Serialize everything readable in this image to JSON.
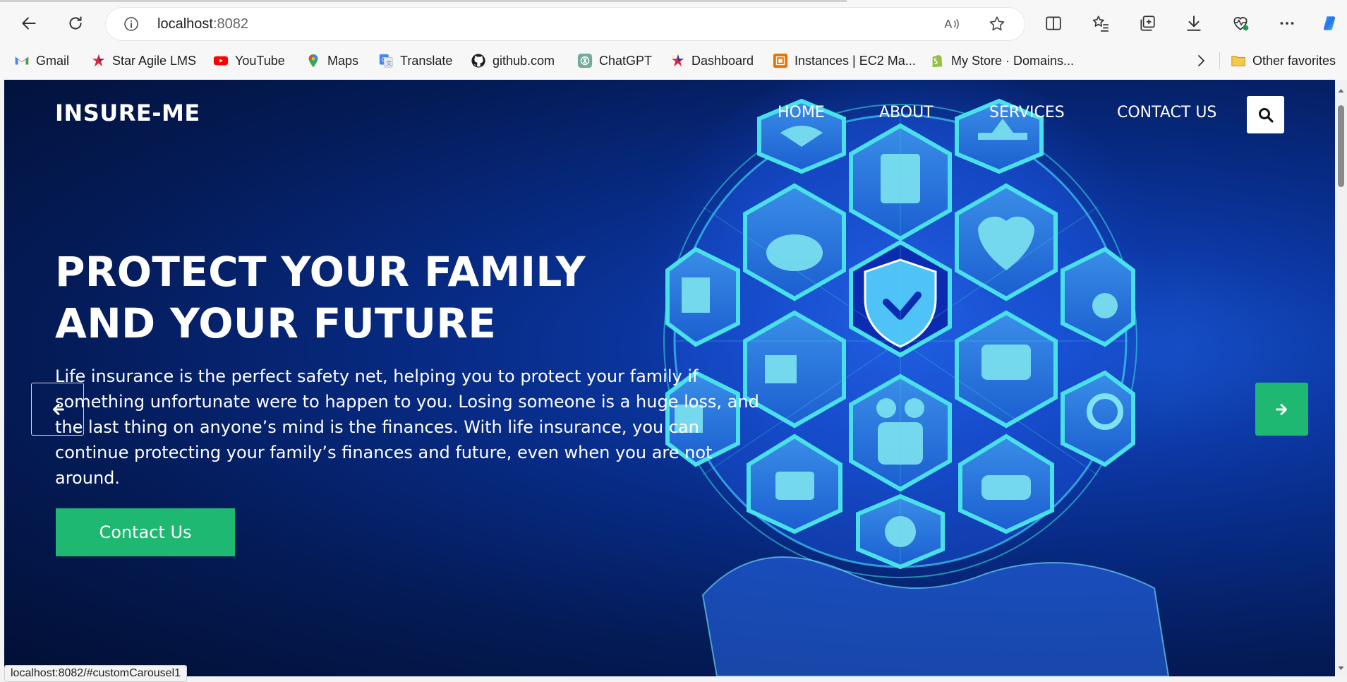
{
  "browser": {
    "address": {
      "host": "localhost",
      "port": ":8082"
    },
    "bookmarks": [
      {
        "label": "Gmail",
        "icon": "gmail-icon"
      },
      {
        "label": "Star Agile LMS",
        "icon": "star-agile-icon"
      },
      {
        "label": "YouTube",
        "icon": "youtube-icon"
      },
      {
        "label": "Maps",
        "icon": "maps-icon"
      },
      {
        "label": "Translate",
        "icon": "translate-icon"
      },
      {
        "label": "github.com",
        "icon": "github-icon"
      },
      {
        "label": "ChatGPT",
        "icon": "chatgpt-icon"
      },
      {
        "label": "Dashboard",
        "icon": "star-agile-icon"
      },
      {
        "label": "Instances | EC2 Ma...",
        "icon": "aws-icon"
      },
      {
        "label": "My Store · Domains...",
        "icon": "shopify-icon"
      }
    ],
    "other_favorites": "Other favorites",
    "status_url": "localhost:8082/#customCarousel1"
  },
  "site": {
    "brand": "INSURE-ME",
    "nav": [
      "HOME",
      "ABOUT",
      "SERVICES",
      "CONTACT US"
    ]
  },
  "hero": {
    "title_line1": "PROTECT YOUR FAMILY",
    "title_line2": "AND YOUR FUTURE",
    "text": "Life insurance is the perfect safety net, helping you to protect your family if something unfortunate were to happen to you. Losing someone is a huge loss, and the last thing on anyone’s mind is the finances. With life insurance, you can continue protecting your family’s finances and future, even when you are not around.",
    "cta_label": "Contact Us"
  },
  "colors": {
    "accent_green": "#1fb872",
    "hero_bg": "#041b57",
    "hex_teal": "#3fd0d9"
  }
}
